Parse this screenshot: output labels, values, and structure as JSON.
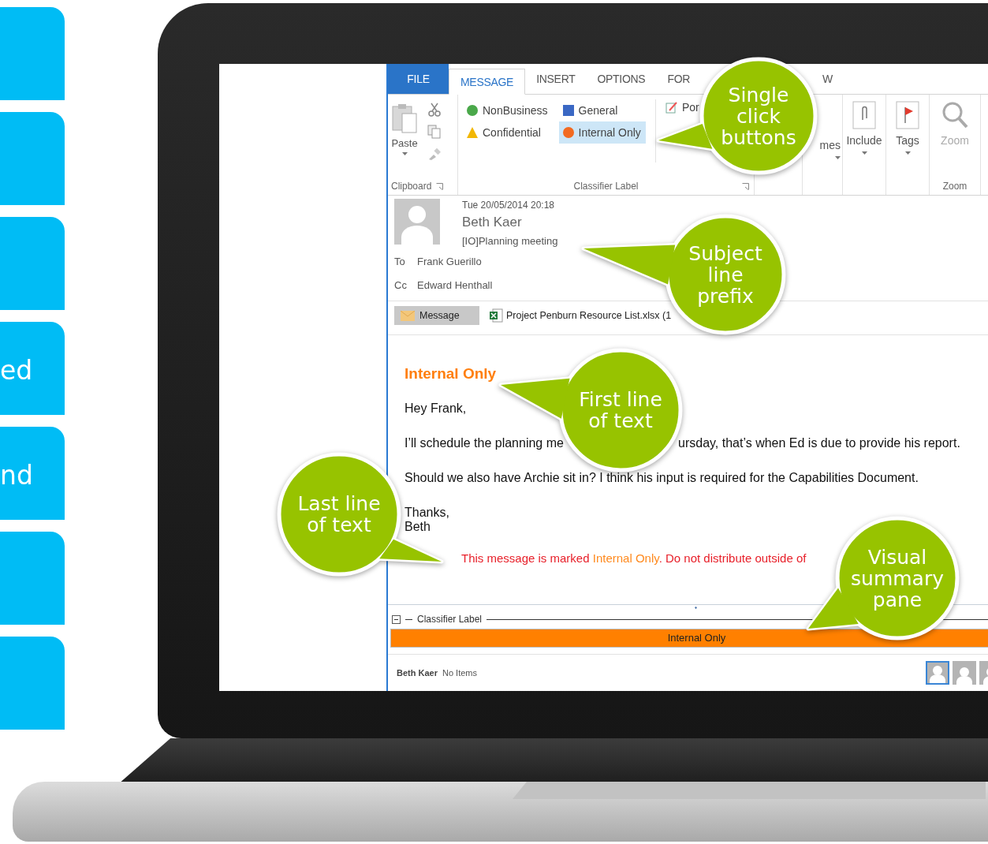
{
  "side_tabs": [
    {
      "kind": "plain"
    },
    {
      "kind": "plain"
    },
    {
      "kind": "plain"
    },
    {
      "kind": "labeled",
      "label": "ed"
    },
    {
      "kind": "labeled",
      "label": "nd"
    },
    {
      "kind": "plain"
    },
    {
      "kind": "plain"
    }
  ],
  "ribbon": {
    "tabs": [
      {
        "label": "FILE",
        "kind": "file",
        "selected": false
      },
      {
        "label": "MESSAGE",
        "kind": "tab",
        "selected": true
      },
      {
        "label": "INSERT",
        "kind": "tab",
        "selected": false
      },
      {
        "label": "OPTIONS",
        "kind": "tab",
        "selected": false
      },
      {
        "label": "FOR",
        "kind": "tab",
        "selected": false
      },
      {
        "label": "W",
        "kind": "tab",
        "selected": false
      }
    ],
    "clipboard": {
      "paste": "Paste",
      "group": "Clipboard"
    },
    "classifier": {
      "items": [
        {
          "label": "NonBusiness",
          "kind": "circle",
          "color": "#4aa84a",
          "selected": false
        },
        {
          "label": "Confidential",
          "kind": "triangle",
          "color": "#f2b705",
          "selected": false
        },
        {
          "label": "General",
          "kind": "square",
          "color": "#3a68c4",
          "selected": false
        },
        {
          "label": "Internal Only",
          "kind": "circle",
          "color": "#f26a21",
          "selected": true
        }
      ],
      "extra": "Por",
      "group": "Classifier Label"
    },
    "buttons": [
      {
        "label": "mes",
        "kind": "plain"
      },
      {
        "label": "Include",
        "kind": "clip"
      },
      {
        "label": "Tags",
        "kind": "flag"
      }
    ],
    "zoom": {
      "label": "Zoom",
      "group": "Zoom",
      "disabled": true
    }
  },
  "message": {
    "date": "Tue 20/05/2014 20:18",
    "sender": "Beth Kaer",
    "subject": "[IO]Planning meeting",
    "to_label": "To",
    "to": "Frank Guerillo",
    "cc_label": "Cc",
    "cc": "Edward Henthall",
    "attachments": [
      {
        "label": "Message",
        "kind": "message",
        "selected": true
      },
      {
        "label": "Project Penburn Resource List.xlsx (1",
        "kind": "excel",
        "selected": false
      }
    ]
  },
  "body": {
    "label_line": "Internal Only",
    "paragraphs": [
      {
        "kind": "line",
        "texts": [
          "Hey Frank,"
        ]
      },
      {
        "kind": "split",
        "texts": [
          "I’ll schedule the planning me",
          "ursday, that’s when Ed is due to provide his report."
        ]
      },
      {
        "kind": "line",
        "texts": [
          "Should we also have Archie sit in? I think his input is required for the Capabilities Document."
        ]
      },
      {
        "kind": "stack",
        "texts": [
          "Thanks,",
          "Beth"
        ]
      }
    ],
    "notice": [
      {
        "text": "This message is marked ",
        "kind": "warning"
      },
      {
        "text": "Internal Only",
        "kind": "label"
      },
      {
        "text": ". Do not distribute outside of",
        "kind": "warning"
      }
    ]
  },
  "summary_pane": {
    "title": "Classifier Label",
    "label": "Internal Only",
    "color": "#ff8000"
  },
  "status": {
    "user": "Beth Kaer",
    "items": "No Items",
    "people": [
      {
        "selected": true
      },
      {
        "selected": false
      },
      {
        "selected": false
      }
    ]
  },
  "callouts": [
    {
      "text": "Single\nclick\nbuttons"
    },
    {
      "text": "Subject\nline\nprefix"
    },
    {
      "text": "First line\nof text"
    },
    {
      "text": "Last line\nof text"
    },
    {
      "text": "Visual\nsummary\npane"
    }
  ]
}
